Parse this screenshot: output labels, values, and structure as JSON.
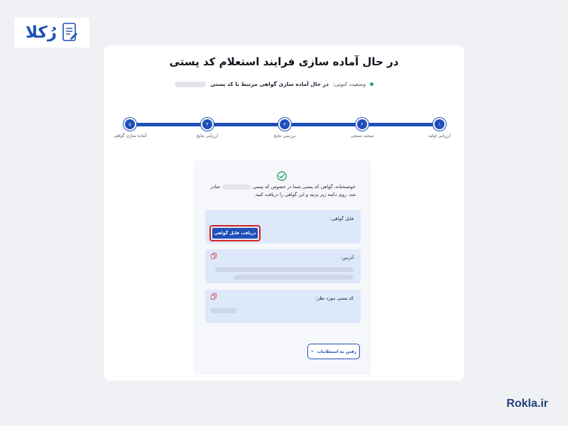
{
  "brand": {
    "logo_text": "رُکلا",
    "url": "Rokla.ir",
    "color": "#1f4fb8"
  },
  "card": {
    "title": "در حال آماده سازی فرایند استعلام کد پستی"
  },
  "status": {
    "label": "وضعیت کنونی:",
    "value": "در حال آماده سازی گواهی مرتبط با کد پستی",
    "dot_color": "#2aa56a"
  },
  "steps": [
    {
      "number": "۱",
      "label": "ارزیابی اولیه"
    },
    {
      "number": "۲",
      "label": "صحت سنجی"
    },
    {
      "number": "۳",
      "label": "بررسی نتایج"
    },
    {
      "number": "۴",
      "label": "ارزیابی نتایج"
    },
    {
      "number": "۵",
      "label": "آماده سازی گواهی"
    }
  ],
  "result": {
    "msg_part1": "خوشبختانه، گواهی کد پستی شما در خصوص کد پستی",
    "msg_part2": "صادر شد. روی دکمه زیر بزنید و این گواهی را دریافت کنید.",
    "file_label": "فایل گواهی:",
    "download_button": "دریافت فایل گواهی",
    "address_label": "آدرس:",
    "postal_label": "کد پستی مورد نظر:",
    "goto_button": "رفتن به استعلامات",
    "icons": {
      "check": "check-circle-icon",
      "copy": "copy-icon",
      "chevron": "chevron-left-icon"
    }
  }
}
